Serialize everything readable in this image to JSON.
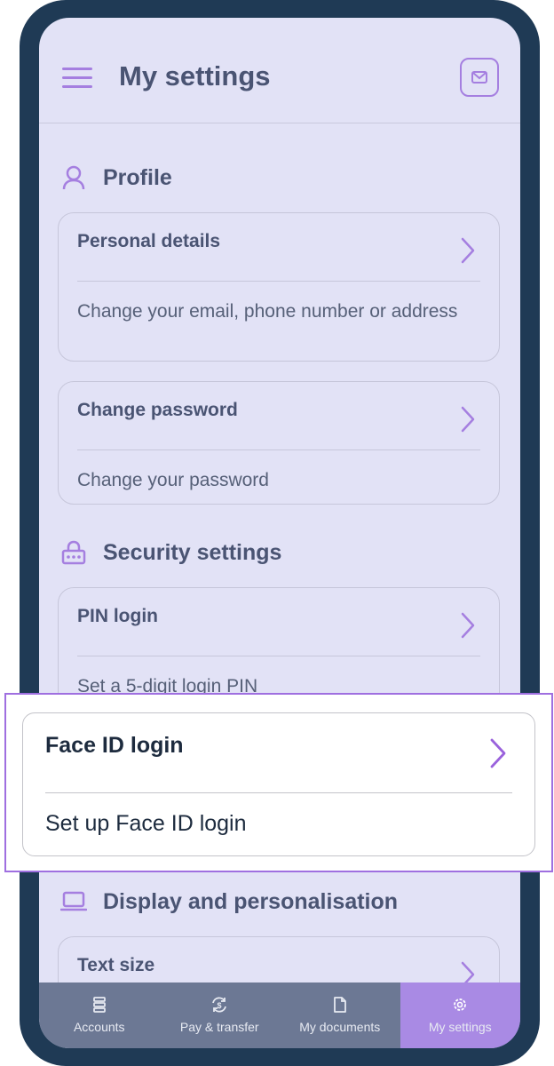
{
  "header": {
    "title": "My settings"
  },
  "sections": {
    "profile": "Profile",
    "security": "Security settings",
    "display": "Display and personalisation"
  },
  "cards": {
    "personal": {
      "title": "Personal details",
      "desc": "Change your email, phone number or address"
    },
    "password": {
      "title": "Change password",
      "desc": "Change your password"
    },
    "pin": {
      "title": "PIN login",
      "desc": "Set a 5-digit login PIN"
    },
    "faceid": {
      "title": "Face ID login",
      "desc": "Set up Face ID login"
    },
    "textsize": {
      "title": "Text size"
    }
  },
  "nav": {
    "accounts": "Accounts",
    "pay": "Pay & transfer",
    "docs": "My documents",
    "settings": "My settings",
    "active": "My settings"
  },
  "colors": {
    "accent": "#a57fe0",
    "frame": "#1f3a55",
    "screen_bg": "#e2e2f6",
    "nav_bg": "#6c7894",
    "nav_active": "#a98ae4"
  },
  "icons": {
    "menu": "hamburger-icon",
    "mail": "mail-icon",
    "profile": "person-icon",
    "security": "lock-icon",
    "display": "laptop-icon",
    "chevron": "chevron-right-icon",
    "accounts": "stack-icon",
    "pay": "dollar-cycle-icon",
    "docs": "document-icon",
    "settings": "gear-icon"
  }
}
